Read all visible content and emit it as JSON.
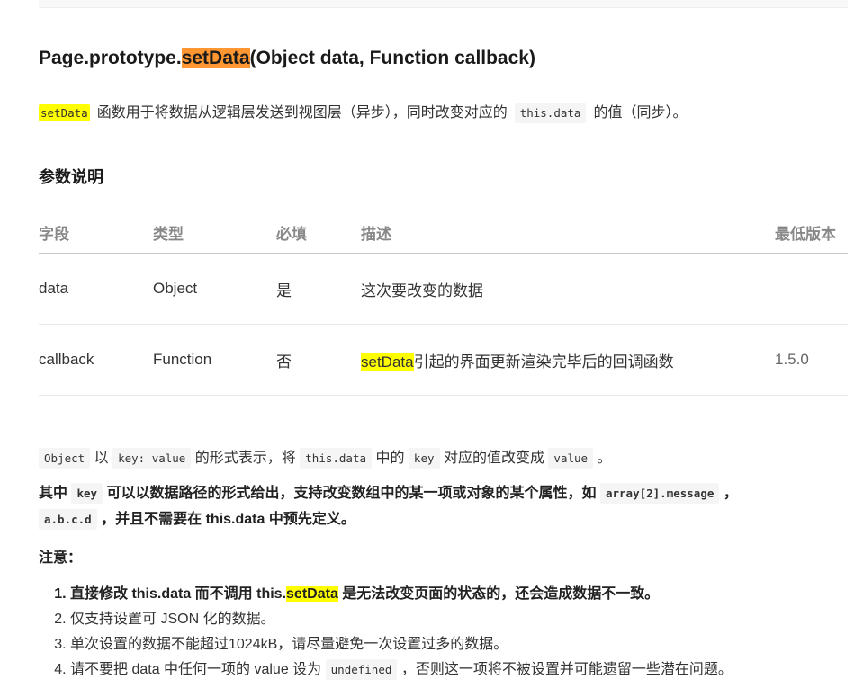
{
  "title": {
    "prefix": "Page.prototype.",
    "highlight": "setData",
    "suffix": "(Object data, Function callback)"
  },
  "intro": {
    "code_setdata": "setData",
    "text1": "函数用于将数据从逻辑层发送到视图层（异步），同时改变对应的",
    "code_thisdata": "this.data",
    "text2": "的值（同步）。"
  },
  "params": {
    "heading": "参数说明",
    "headers": [
      "字段",
      "类型",
      "必填",
      "描述",
      "最低版本"
    ],
    "rows": [
      {
        "field": "data",
        "type": "Object",
        "required": "是",
        "desc_highlight": "",
        "desc": "这次要改变的数据",
        "version": ""
      },
      {
        "field": "callback",
        "type": "Function",
        "required": "否",
        "desc_highlight": "setData",
        "desc": "引起的界面更新渲染完毕后的回调函数",
        "version": "1.5.0"
      }
    ]
  },
  "object_desc": {
    "c1": "Object",
    "t1": "以",
    "c2": "key: value",
    "t2": "的形式表示，将",
    "c3": "this.data",
    "t3": "中的",
    "c4": "key",
    "t4": "对应的值改变成",
    "c5": "value",
    "t5": "。"
  },
  "key_desc": {
    "t1": "其中",
    "c1": "key",
    "t2": "可以以数据路径的形式给出，支持改变数组中的某一项或对象的某个属性，如",
    "c2": "array[2].message",
    "t3": "，",
    "c3": "a.b.c.d",
    "t4": "，并且不需要在 this.data 中预先定义。"
  },
  "notes": {
    "heading": "注意：",
    "item1": {
      "a": "直接修改 this.data 而不调用 this.",
      "hl": "setData",
      "b": " 是无法改变页面的状态的，还会造成数据不一致。"
    },
    "item2": "仅支持设置可 JSON 化的数据。",
    "item3": "单次设置的数据不能超过1024kB，请尽量避免一次设置过多的数据。",
    "item4": {
      "a": "请不要把 data 中任何一项的 value 设为",
      "code": "undefined",
      "b": "，否则这一项将不被设置并可能遗留一些潜在问题。"
    }
  },
  "colors": {
    "highlight_orange": "#ff9632",
    "highlight_yellow": "#ffff00",
    "code_bg": "#f5f5f5"
  }
}
